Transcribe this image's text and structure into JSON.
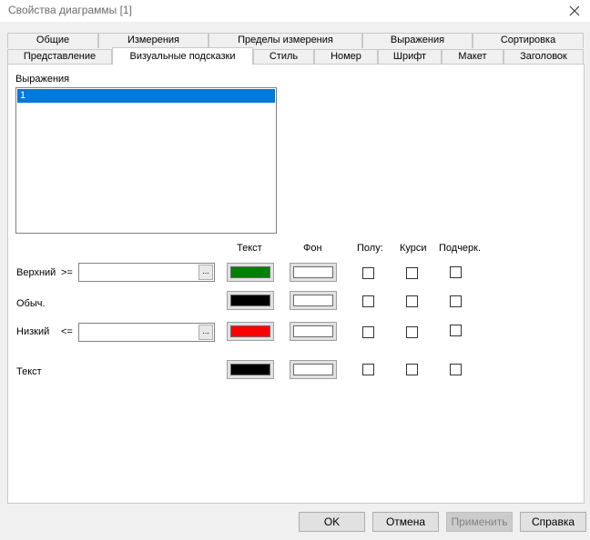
{
  "window": {
    "title": "Свойства диаграммы [1]"
  },
  "tabs_row1": [
    "Общие",
    "Измерения",
    "Пределы измерения",
    "Выражения",
    "Сортировка"
  ],
  "tabs_row2": [
    "Представление",
    "Визуальные подсказки",
    "Стиль",
    "Номер",
    "Шрифт",
    "Макет",
    "Заголовок"
  ],
  "active_tab": "Визуальные подсказки",
  "expressions": {
    "label": "Выражения",
    "items": [
      "1"
    ]
  },
  "columns": {
    "text": "Текст",
    "bg": "Фон",
    "bold": "Полу:",
    "italic": "Курси",
    "underline": "Подчерк."
  },
  "rows": {
    "upper": {
      "label": "Верхний",
      "op": ">=",
      "value": "",
      "browse": "...",
      "text_color": "#008000",
      "bg_color": "#ffffff"
    },
    "normal": {
      "label": "Обыч.",
      "text_color": "#000000",
      "bg_color": "#ffffff"
    },
    "lower": {
      "label": "Низкий",
      "op": "<=",
      "value": "",
      "browse": "...",
      "text_color": "#ff0000",
      "bg_color": "#ffffff"
    },
    "text": {
      "label": "Текст",
      "text_color": "#000000",
      "bg_color": "#ffffff"
    }
  },
  "buttons": {
    "ok": "OK",
    "cancel": "Отмена",
    "apply": "Применить",
    "help": "Справка"
  }
}
